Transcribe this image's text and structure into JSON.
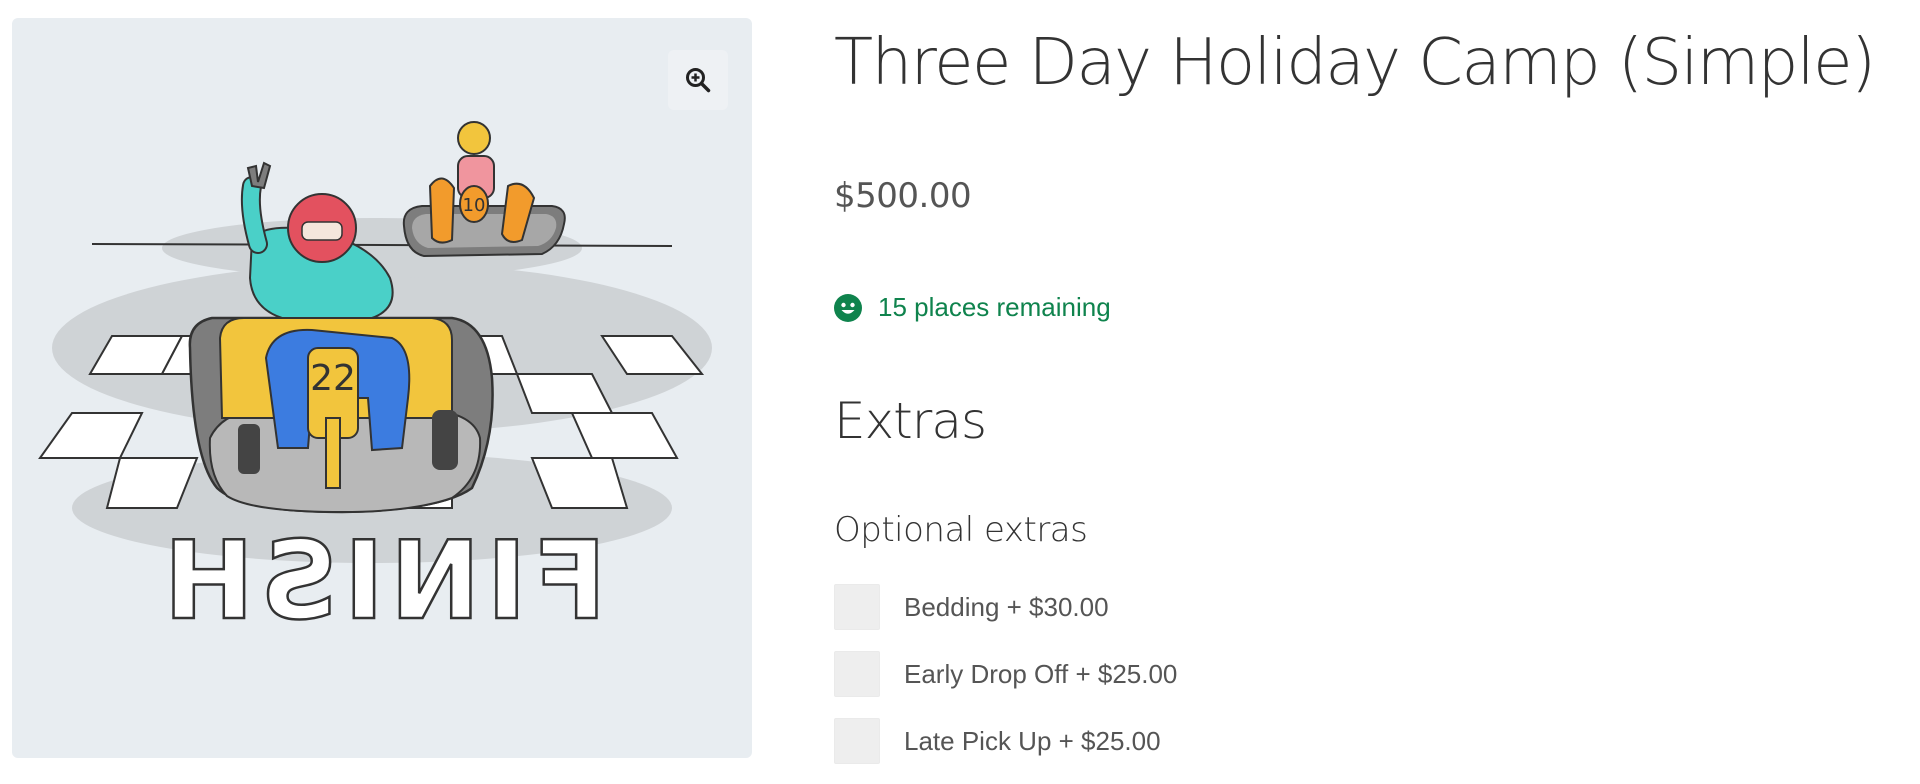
{
  "product": {
    "title": "Three Day Holiday Camp (Simple)",
    "price": "$500.00",
    "stock_text": "15 places remaining",
    "stock_icon": "smiley-icon"
  },
  "gallery": {
    "zoom_icon": "zoom-in-icon",
    "image_text": {
      "banner": "FINISH",
      "kart_number_front": "22",
      "kart_number_back": "10"
    }
  },
  "extras": {
    "heading": "Extras",
    "group_label": "Optional extras",
    "items": [
      {
        "label": "Bedding + $30.00",
        "checked": false
      },
      {
        "label": "Early Drop Off + $25.00",
        "checked": false
      },
      {
        "label": "Late Pick Up + $25.00",
        "checked": false
      }
    ]
  },
  "colors": {
    "stock_green": "#0f834d",
    "title_text": "#333333",
    "body_text": "#555555",
    "gallery_bg": "#e8edf1",
    "checkbox_bg": "#eeeeee"
  }
}
